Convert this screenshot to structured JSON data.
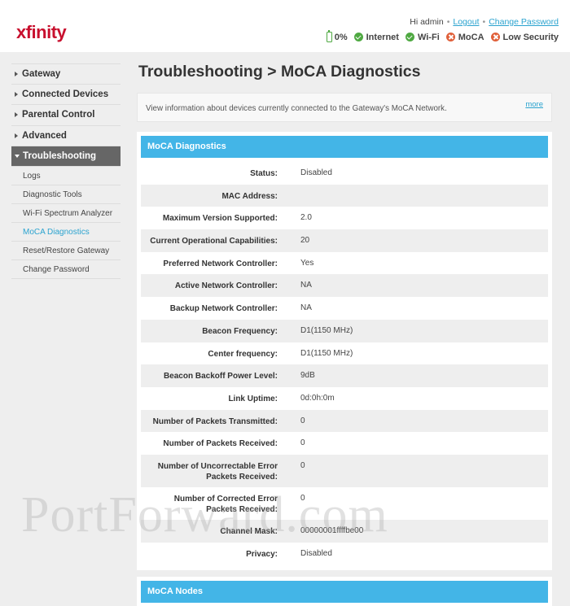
{
  "brand": {
    "logo_text": "xfinity",
    "accent": "#c8102e"
  },
  "user": {
    "greeting": "Hi admin",
    "logout": "Logout",
    "change_password": "Change Password"
  },
  "status": {
    "battery": "0%",
    "items": [
      {
        "label": "Internet",
        "state": "ok",
        "icon": "check-circle-icon"
      },
      {
        "label": "Wi-Fi",
        "state": "ok",
        "icon": "check-circle-icon"
      },
      {
        "label": "MoCA",
        "state": "bad",
        "icon": "x-circle-icon"
      },
      {
        "label": "Low Security",
        "state": "bad",
        "icon": "x-circle-icon"
      }
    ]
  },
  "nav": {
    "items": [
      {
        "label": "Gateway"
      },
      {
        "label": "Connected Devices"
      },
      {
        "label": "Parental Control"
      },
      {
        "label": "Advanced"
      },
      {
        "label": "Troubleshooting"
      }
    ],
    "sub_items": [
      {
        "label": "Logs"
      },
      {
        "label": "Diagnostic Tools"
      },
      {
        "label": "Wi-Fi Spectrum Analyzer"
      },
      {
        "label": "MoCA Diagnostics"
      },
      {
        "label": "Reset/Restore Gateway"
      },
      {
        "label": "Change Password"
      }
    ]
  },
  "page": {
    "title": "Troubleshooting > MoCA Diagnostics",
    "info": "View information about devices currently connected to the Gateway's MoCA Network.",
    "more": "more"
  },
  "diagnostics": {
    "header": "MoCA Diagnostics",
    "rows": [
      {
        "label": "Status:",
        "value": "Disabled"
      },
      {
        "label": "MAC Address:",
        "value": ""
      },
      {
        "label": "Maximum Version Supported:",
        "value": "2.0"
      },
      {
        "label": "Current Operational Capabilities:",
        "value": "20"
      },
      {
        "label": "Preferred Network Controller:",
        "value": "Yes"
      },
      {
        "label": "Active Network Controller:",
        "value": "NA"
      },
      {
        "label": "Backup Network Controller:",
        "value": "NA"
      },
      {
        "label": "Beacon Frequency:",
        "value": "D1(1150 MHz)"
      },
      {
        "label": "Center frequency:",
        "value": "D1(1150 MHz)"
      },
      {
        "label": "Beacon Backoff Power Level:",
        "value": "9dB"
      },
      {
        "label": "Link Uptime:",
        "value": "0d:0h:0m"
      },
      {
        "label": "Number of Packets Transmitted:",
        "value": "0"
      },
      {
        "label": "Number of Packets Received:",
        "value": "0"
      },
      {
        "label": "Number of Uncorrectable Error Packets Received:",
        "value": "0"
      },
      {
        "label": "Number of Corrected Error Packets Received:",
        "value": "0"
      },
      {
        "label": "Channel Mask:",
        "value": "00000001ffffbe00"
      },
      {
        "label": "Privacy:",
        "value": "Disabled"
      }
    ]
  },
  "nodes": {
    "header": "MoCA Nodes"
  },
  "watermark": "PortForward.com",
  "colors": {
    "header_blue": "#43b5e7",
    "link": "#2ba3cf",
    "ok": "#4fa942",
    "bad": "#e0603a"
  }
}
